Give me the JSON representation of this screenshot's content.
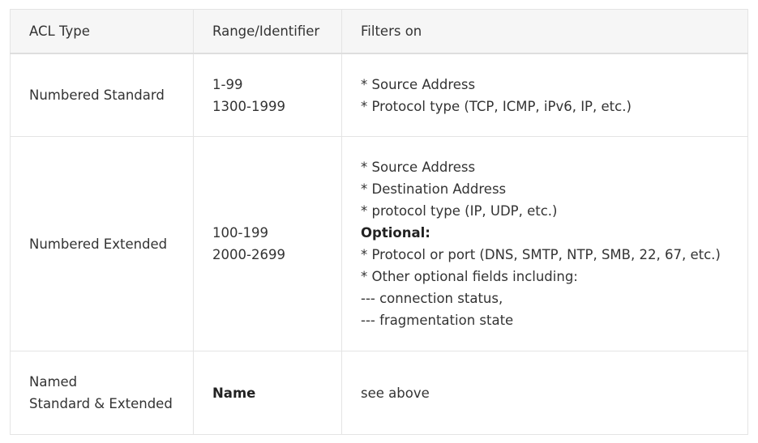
{
  "table": {
    "headers": [
      "ACL Type",
      "Range/Identifier",
      "Filters on"
    ],
    "rows": [
      {
        "type": [
          "Numbered Standard"
        ],
        "range": [
          "1-99",
          "1300-1999"
        ],
        "filters": [
          "* Source Address",
          "* Protocol type (TCP, ICMP, iPv6, IP, etc.)"
        ]
      },
      {
        "type": [
          "Numbered Extended"
        ],
        "range": [
          "100-199",
          "2000-2699"
        ],
        "filters": [
          "* Source Address",
          "* Destination Address",
          "* protocol type (IP, UDP, etc.)",
          "Optional:",
          "* Protocol or port (DNS, SMTP, NTP, SMB, 22, 67, etc.)",
          "* Other optional fields including:",
          "--- connection status,",
          "--- fragmentation state"
        ]
      },
      {
        "type": [
          "Named",
          "Standard & Extended"
        ],
        "range": [
          "Name"
        ],
        "filters": [
          "see above"
        ]
      }
    ]
  }
}
